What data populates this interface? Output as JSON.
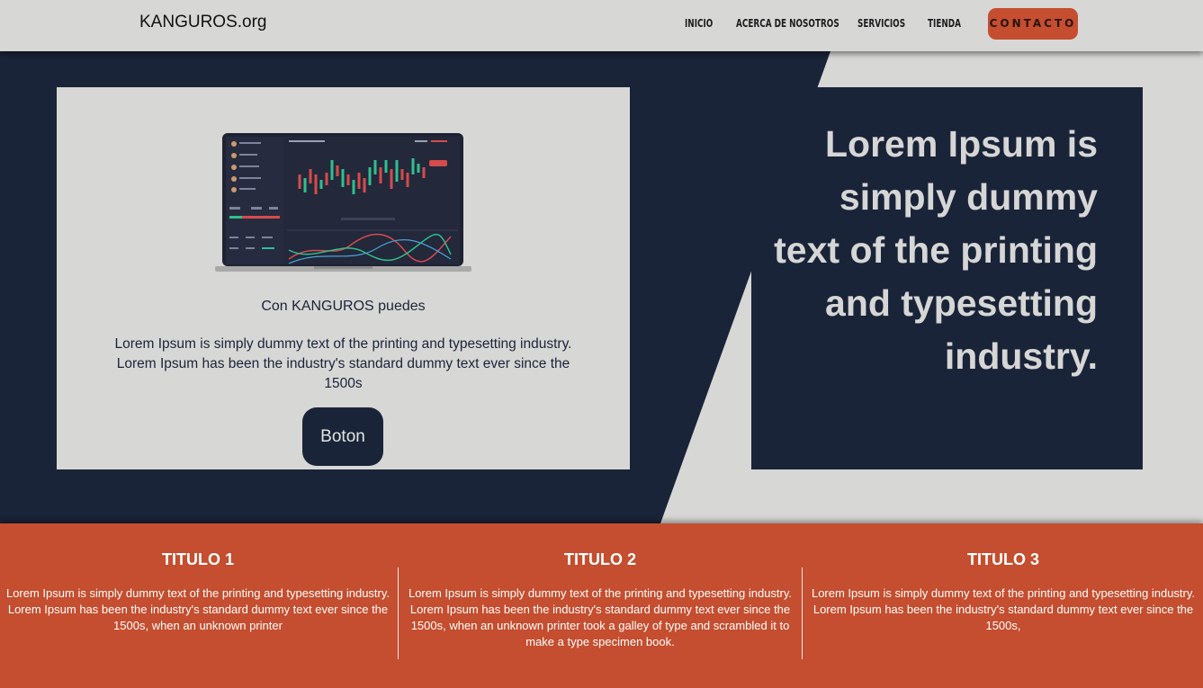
{
  "header": {
    "logo": "KANGUROS.org",
    "nav": [
      "INICIO",
      "ACERCA DE NOSOTROS",
      "SERVICIOS",
      "TIENDA"
    ],
    "contact_label": "CONTACTO"
  },
  "hero": {
    "card_title": "Con KANGUROS puedes",
    "card_text": "Lorem Ipsum is simply dummy text of the printing and typesetting industry. Lorem Ipsum has been the industry's standard dummy text ever since the 1500s",
    "button_label": "Boton",
    "quote": "Lorem Ipsum is simply dummy text of the printing and typesetting industry."
  },
  "features": [
    {
      "title": "TITULO 1",
      "text": "Lorem Ipsum is simply dummy text of the printing and typesetting industry. Lorem Ipsum has been the industry's standard dummy text ever since the 1500s, when an unknown printer"
    },
    {
      "title": "TITULO 2",
      "text": "Lorem Ipsum is simply dummy text of the printing and typesetting industry. Lorem Ipsum has been the industry's standard dummy text ever since the 1500s, when an unknown printer took a galley of type and scrambled it to make a type specimen book."
    },
    {
      "title": "TITULO 3",
      "text": "Lorem Ipsum is simply dummy text of the printing and typesetting industry. Lorem Ipsum has been the industry's standard dummy text ever since the 1500s,"
    }
  ],
  "colors": {
    "navy": "#1a2438",
    "accent": "#c44e2f",
    "light": "#d7d7d6"
  }
}
